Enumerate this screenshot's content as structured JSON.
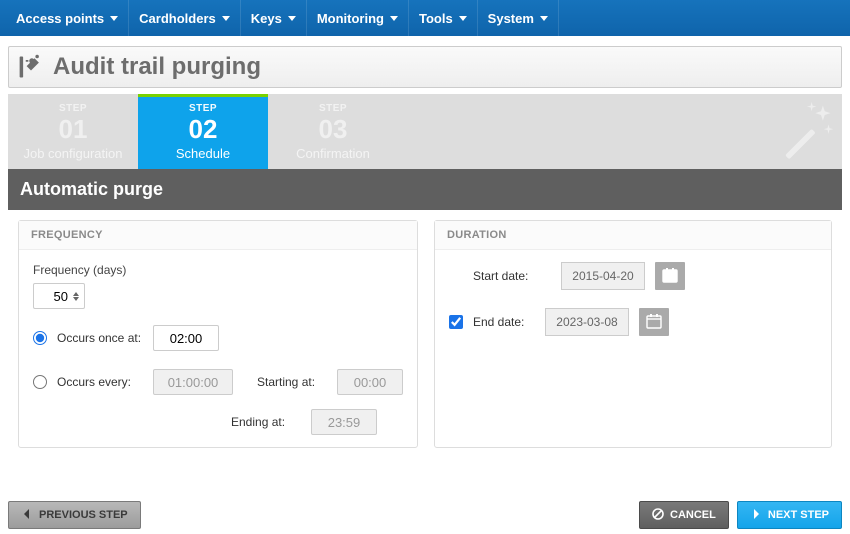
{
  "menu": {
    "items": [
      "Access points",
      "Cardholders",
      "Keys",
      "Monitoring",
      "Tools",
      "System"
    ]
  },
  "page": {
    "title": "Audit trail purging"
  },
  "wizard": {
    "step_word": "STEP",
    "steps": [
      {
        "num": "01",
        "name": "Job configuration"
      },
      {
        "num": "02",
        "name": "Schedule"
      },
      {
        "num": "03",
        "name": "Confirmation"
      }
    ],
    "active_index": 1,
    "section_title": "Automatic purge"
  },
  "frequency": {
    "panel_title": "FREQUENCY",
    "days_label": "Frequency (days)",
    "days_value": "50",
    "occurs_once_label": "Occurs once at:",
    "occurs_once_time": "02:00",
    "occurs_every_label": "Occurs every:",
    "occurs_every_value": "01:00:00",
    "starting_at_label": "Starting at:",
    "starting_at_value": "00:00",
    "ending_at_label": "Ending at:",
    "ending_at_value": "23:59",
    "selected": "once"
  },
  "duration": {
    "panel_title": "DURATION",
    "start_label": "Start date:",
    "start_value": "2015-04-20",
    "end_label": "End date:",
    "end_value": "2023-03-08",
    "end_checked": true
  },
  "buttons": {
    "previous": "PREVIOUS STEP",
    "cancel": "CANCEL",
    "next": "NEXT STEP"
  }
}
